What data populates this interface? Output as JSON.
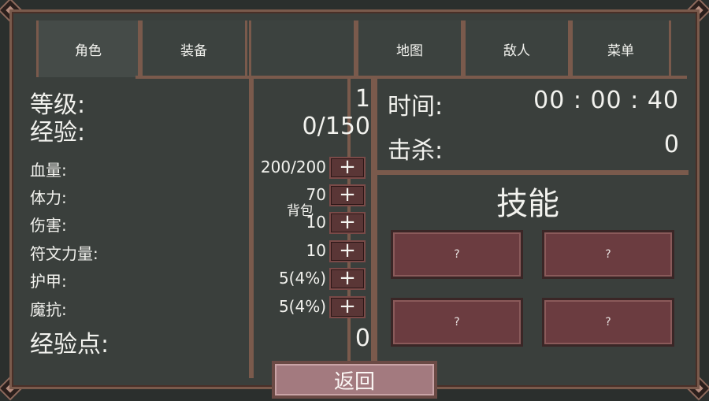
{
  "tabs": [
    {
      "label": "角色"
    },
    {
      "label": "装备"
    },
    {
      "label": ""
    },
    {
      "label": "地图"
    },
    {
      "label": "敌人"
    },
    {
      "label": "菜单"
    }
  ],
  "stats": {
    "level": {
      "label": "等级:",
      "value": "1"
    },
    "exp": {
      "label": "经验:",
      "value": "0/150"
    },
    "rows": [
      {
        "label": "血量:",
        "value": "200/200"
      },
      {
        "label": "体力:",
        "value": "70"
      },
      {
        "label": "伤害:",
        "value": "10"
      },
      {
        "label": "符文力量:",
        "value": "10"
      },
      {
        "label": "护甲:",
        "value": "5(4%)"
      },
      {
        "label": "魔抗:",
        "value": "5(4%)"
      }
    ],
    "exp_points": {
      "label": "经验点:",
      "value": "0"
    },
    "plus_glyph": "+"
  },
  "backpack_label": "背包",
  "info": {
    "time_label": "时间:",
    "time_value": "00 : 00 : 40",
    "kills_label": "击杀:",
    "kills_value": "0"
  },
  "skills": {
    "title": "技能",
    "slots": [
      "?",
      "?",
      "?",
      "?"
    ]
  },
  "back_label": "返回",
  "colors": {
    "panel": "#3a3f3c",
    "border": "#7a5a4c",
    "button": "#5a3636",
    "skill_slot": "#6b3c40",
    "back_button": "#a37a7f"
  }
}
